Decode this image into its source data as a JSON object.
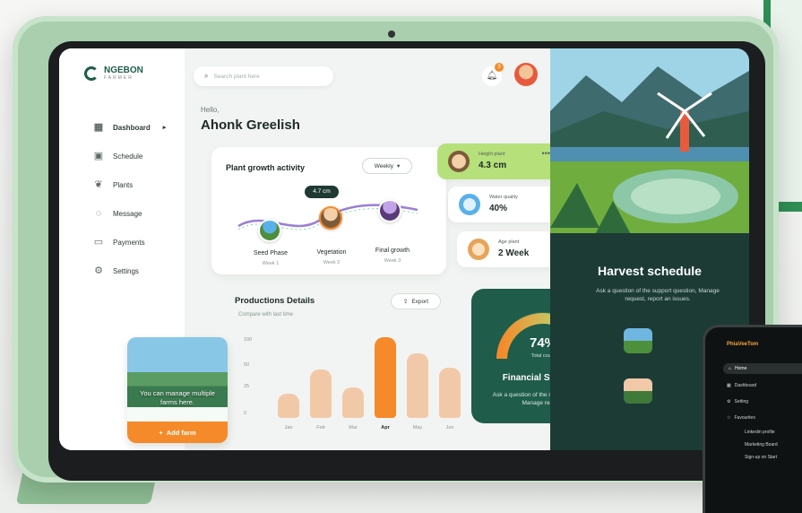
{
  "brand": {
    "name": "NGEBON",
    "sub": "FARMER"
  },
  "search": {
    "placeholder": "Search plant here"
  },
  "notifications": {
    "count": "3"
  },
  "greeting": {
    "hello": "Hello,",
    "name": "Ahonk Greelish"
  },
  "sidebar": {
    "items": [
      {
        "label": "Dashboard",
        "icon": "grid-icon",
        "active": true
      },
      {
        "label": "Schedule",
        "icon": "calendar-icon"
      },
      {
        "label": "Plants",
        "icon": "leaf-icon"
      },
      {
        "label": "Message",
        "icon": "chat-icon"
      },
      {
        "label": "Payments",
        "icon": "card-icon"
      },
      {
        "label": "Settings",
        "icon": "gear-icon"
      }
    ]
  },
  "promo": {
    "text": "You can manage multiple farms here.",
    "button": "Add farm"
  },
  "growth": {
    "title": "Plant growth activity",
    "filter": "Weekly",
    "tooltip": "4.7 cm",
    "stages": [
      {
        "label": "Seed Phase",
        "week": "Week 1"
      },
      {
        "label": "Vegetation",
        "week": "Week 2"
      },
      {
        "label": "Final growth",
        "week": "Week 3"
      }
    ]
  },
  "stats": [
    {
      "label": "Height plant",
      "value": "4.3 cm"
    },
    {
      "label": "Water quality",
      "value": "40%"
    },
    {
      "label": "Age plant",
      "value": "2 Week"
    }
  ],
  "productions": {
    "title": "Productions Details",
    "subtitle": "Compare with last time",
    "export": "Export"
  },
  "chart_data": {
    "type": "bar",
    "categories": [
      "Jan",
      "Feb",
      "Mar",
      "Apr",
      "May",
      "Jun"
    ],
    "values": [
      30,
      60,
      38,
      100,
      80,
      62
    ],
    "highlight": "Apr",
    "yticks": [
      "100",
      "50",
      "25",
      "0"
    ],
    "title": "Productions Details",
    "ylim": [
      0,
      100
    ]
  },
  "financial": {
    "percent": "74%",
    "caption": "Total count",
    "title": "Financial Statistics",
    "desc": "Ask a question of the support question, Manage request"
  },
  "harvest": {
    "title": "Harvest schedule",
    "desc": "Ask a question of the support question, Manage request, report an issues."
  },
  "phone": {
    "brand": "PhiaVeeTom",
    "items": [
      "Home",
      "Dashboard",
      "Setting",
      "Favourites",
      "Linkedin profile",
      "Marketing Board",
      "Sign-up on Start"
    ]
  },
  "colors": {
    "accent": "#f58a2a",
    "green": "#1f5c4a",
    "lime": "#b6e07a"
  }
}
